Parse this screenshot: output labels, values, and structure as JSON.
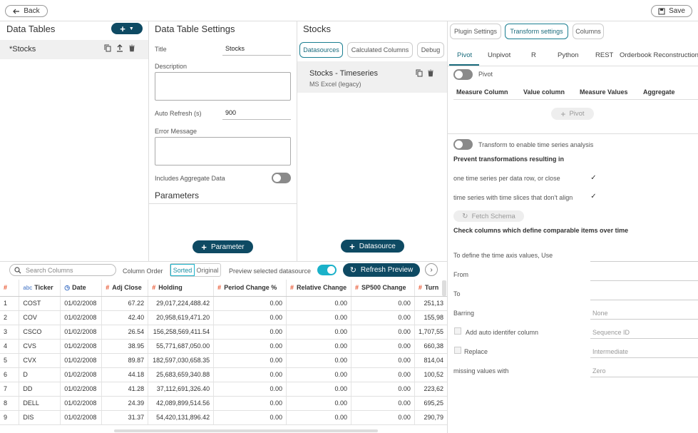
{
  "topbar": {
    "back_label": "Back",
    "save_label": "Save"
  },
  "data_tables": {
    "title": "Data Tables",
    "items": [
      {
        "label": "*Stocks"
      }
    ]
  },
  "settings": {
    "title": "Data Table Settings",
    "title_label": "Title",
    "title_value": "Stocks",
    "description_label": "Description",
    "auto_refresh_label": "Auto Refresh (s)",
    "auto_refresh_value": "900",
    "error_label": "Error Message",
    "aggregate_label": "Includes Aggregate Data",
    "parameters_title": "Parameters",
    "parameter_button": "Parameter"
  },
  "stocks_panel": {
    "title": "Stocks",
    "tabs": [
      "Datasources",
      "Calculated Columns",
      "Debug"
    ],
    "datasource_name": "Stocks - Timeseries",
    "datasource_type": "MS Excel (legacy)",
    "datasource_button": "Datasource"
  },
  "right": {
    "top_tabs": [
      "Plugin Settings",
      "Transform settings",
      "Columns"
    ],
    "sub_tabs": [
      "Pivot",
      "Unpivot",
      "R",
      "Python",
      "REST",
      "Orderbook Reconstruction"
    ],
    "pivot_label": "Pivot",
    "pivot_headers": [
      "Measure Column",
      "Value column",
      "Measure Values",
      "Aggregate"
    ],
    "pivot_button": "Pivot",
    "ts_toggle_label": "Transform to enable time series analysis",
    "prevent_title": "Prevent transformations resulting in",
    "prevent_1": "one time series per data row, or close",
    "prevent_2": "time series with time slices that don't align",
    "fetch_schema": "Fetch Schema",
    "check_columns": "Check columns which define comparable items over time",
    "time_axis_label": "To define the time axis values, Use",
    "from_label": "From",
    "to_label": "To",
    "barring_label": "Barring",
    "barring_value": "None",
    "auto_id_label": "Add auto identifer column",
    "auto_id_value": "Sequence ID",
    "replace_label": "Replace",
    "replace_value": "Intermediate",
    "missing_label": "missing values with",
    "missing_value": "Zero"
  },
  "toolbar": {
    "search_placeholder": "Search Columns",
    "column_order_label": "Column Order",
    "sorted": "Sorted",
    "original": "Original",
    "preview_label": "Preview selected datasource",
    "refresh_label": "Refresh Preview"
  },
  "grid": {
    "headers": [
      "#",
      "Ticker",
      "Date",
      "Adj Close",
      "Holding",
      "Period Change %",
      "Relative Change",
      "SP500 Change",
      "Turn"
    ],
    "header_types": [
      "",
      "abc",
      "clock",
      "#",
      "#",
      "#",
      "#",
      "#",
      "#"
    ],
    "rows": [
      [
        "1",
        "COST",
        "01/02/2008",
        "67.22",
        "29,017,224,488.42",
        "0.00",
        "0.00",
        "0.00",
        "251,13"
      ],
      [
        "2",
        "COV",
        "01/02/2008",
        "42.40",
        "20,958,619,471.20",
        "0.00",
        "0.00",
        "0.00",
        "155,98"
      ],
      [
        "3",
        "CSCO",
        "01/02/2008",
        "26.54",
        "156,258,569,411.54",
        "0.00",
        "0.00",
        "0.00",
        "1,707,55"
      ],
      [
        "4",
        "CVS",
        "01/02/2008",
        "38.95",
        "55,771,687,050.00",
        "0.00",
        "0.00",
        "0.00",
        "660,38"
      ],
      [
        "5",
        "CVX",
        "01/02/2008",
        "89.87",
        "182,597,030,658.35",
        "0.00",
        "0.00",
        "0.00",
        "814,04"
      ],
      [
        "6",
        "D",
        "01/02/2008",
        "44.18",
        "25,683,659,340.88",
        "0.00",
        "0.00",
        "0.00",
        "100,52"
      ],
      [
        "7",
        "DD",
        "01/02/2008",
        "41.28",
        "37,112,691,326.40",
        "0.00",
        "0.00",
        "0.00",
        "223,62"
      ],
      [
        "8",
        "DELL",
        "01/02/2008",
        "24.39",
        "42,089,899,514.56",
        "0.00",
        "0.00",
        "0.00",
        "695,25"
      ],
      [
        "9",
        "DIS",
        "01/02/2008",
        "31.37",
        "54,420,131,896.42",
        "0.00",
        "0.00",
        "0.00",
        "290,79"
      ]
    ]
  },
  "colors": {
    "accent": "#0e4a63",
    "toggle_on": "#1ab1c9",
    "hash": "#e8512b"
  }
}
